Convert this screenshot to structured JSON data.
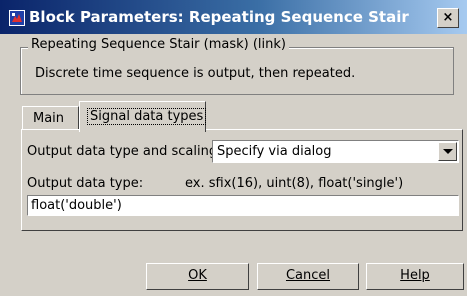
{
  "window": {
    "title": "Block Parameters: Repeating Sequence Stair",
    "close_glyph": "×"
  },
  "group": {
    "legend": "Repeating Sequence Stair (mask) (link)",
    "description": "Discrete time sequence is output, then repeated."
  },
  "tabs": [
    {
      "label": "Main",
      "selected": false
    },
    {
      "label": "Signal data types",
      "selected": true
    }
  ],
  "signal_tab": {
    "scaling_label": "Output data type and scaling:",
    "scaling_value": "Specify via dialog",
    "type_label": "Output data type:",
    "type_examples": "ex.  sfix(16),  uint(8),  float('single')",
    "type_value": "float('double')"
  },
  "buttons": {
    "ok": "OK",
    "cancel": "Cancel",
    "help": "Help"
  },
  "colors": {
    "titlebar_start": "#0a246a",
    "titlebar_end": "#a6caf0",
    "dialog_face": "#d4d0c8"
  }
}
